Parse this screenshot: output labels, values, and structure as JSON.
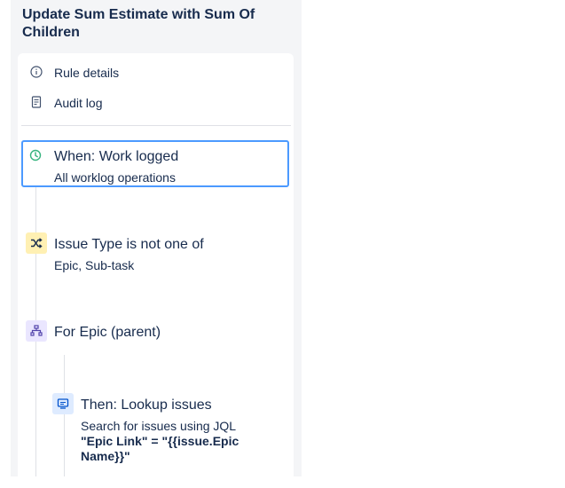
{
  "header": {
    "title": "Update Sum Estimate with Sum Of Children"
  },
  "menu": {
    "rule_details": "Rule details",
    "audit_log": "Audit log"
  },
  "flow": {
    "trigger": {
      "title": "When: Work logged",
      "subtitle": "All worklog operations",
      "icon": "clock-icon",
      "color": "#36b37e"
    },
    "condition": {
      "title": "Issue Type is not one of",
      "subtitle": "Epic, Sub-task",
      "icon": "shuffle-icon",
      "color": "#fff0b3"
    },
    "branch": {
      "title": "For Epic (parent)",
      "icon": "hierarchy-icon",
      "color": "#eae6ff"
    },
    "action": {
      "title": "Then: Lookup issues",
      "subtitle": "Search for issues using JQL",
      "jql_line1": "\"Epic Link\" = \"{{issue.Epic",
      "jql_line2": "Name}}\"",
      "icon": "monitor-icon",
      "color": "#deebff"
    }
  },
  "colors": {
    "selected_border": "#4c9aff",
    "panel_bg": "#f4f5f7"
  }
}
